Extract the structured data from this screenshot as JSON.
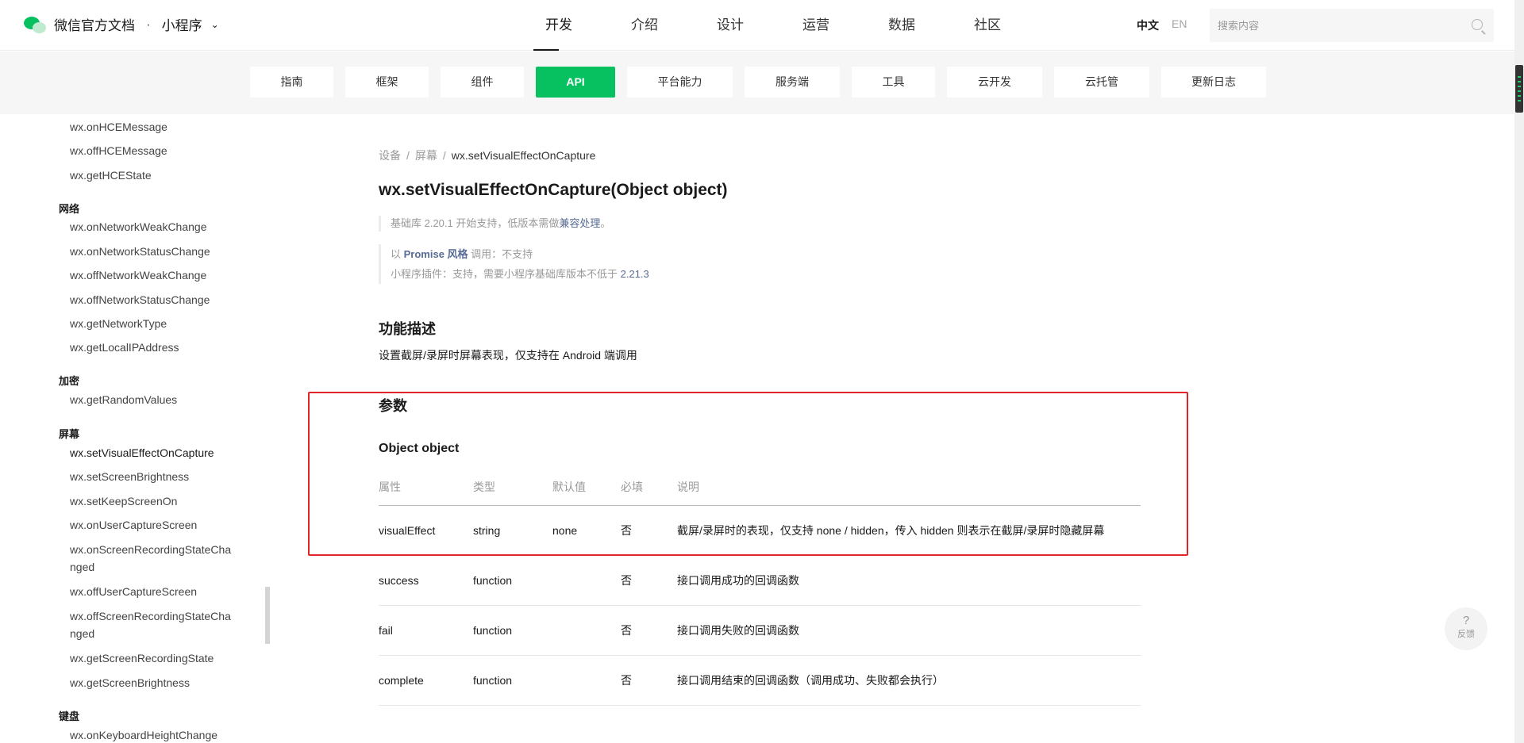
{
  "header": {
    "brand_title": "微信官方文档",
    "brand_dot": "·",
    "brand_section": "小程序",
    "nav": [
      "开发",
      "介绍",
      "设计",
      "运营",
      "数据",
      "社区"
    ],
    "active_nav": "开发",
    "lang_zh": "中文",
    "lang_en": "EN",
    "search_placeholder": "搜索内容"
  },
  "subnav": {
    "items": [
      "指南",
      "框架",
      "组件",
      "API",
      "平台能力",
      "服务端",
      "工具",
      "云开发",
      "云托管",
      "更新日志"
    ],
    "active": "API",
    "accent_color": "#07c160"
  },
  "sidebar": {
    "groups": [
      {
        "title": "",
        "items": [
          "wx.onHCEMessage",
          "wx.offHCEMessage",
          "wx.getHCEState"
        ]
      },
      {
        "title": "网络",
        "items": [
          "wx.onNetworkWeakChange",
          "wx.onNetworkStatusChange",
          "wx.offNetworkWeakChange",
          "wx.offNetworkStatusChange",
          "wx.getNetworkType",
          "wx.getLocalIPAddress"
        ]
      },
      {
        "title": "加密",
        "items": [
          "wx.getRandomValues"
        ]
      },
      {
        "title": "屏幕",
        "items": [
          "wx.setVisualEffectOnCapture",
          "wx.setScreenBrightness",
          "wx.setKeepScreenOn",
          "wx.onUserCaptureScreen",
          "wx.onScreenRecordingStateChanged",
          "wx.offUserCaptureScreen",
          "wx.offScreenRecordingStateChanged",
          "wx.getScreenRecordingState",
          "wx.getScreenBrightness"
        ]
      },
      {
        "title": "键盘",
        "items": [
          "wx.onKeyboardHeightChange"
        ]
      }
    ],
    "wrapped": {
      "onScreenRecordingStateChanged": [
        "wx.onScreenRecordingStateCha",
        "nged"
      ],
      "offScreenRecordingStateChanged": [
        "wx.offScreenRecordingStateCha",
        "nged"
      ]
    }
  },
  "content": {
    "breadcrumb": [
      "设备",
      "屏幕",
      "wx.setVisualEffectOnCapture"
    ],
    "breadcrumb_sep": "/",
    "title": "wx.setVisualEffectOnCapture(Object object)",
    "support_note": {
      "prefix": "基础库 2.20.1 开始支持，低版本需做",
      "link": "兼容处理",
      "suffix": "。"
    },
    "promise_note": {
      "prefix": "以 ",
      "link": "Promise 风格",
      "suffix": " 调用：不支持"
    },
    "plugin_note": {
      "prefix": "小程序插件：支持，需要小程序基础库版本不低于 ",
      "link": "2.21.3"
    },
    "section_desc_title": "功能描述",
    "section_desc": "设置截屏/录屏时屏幕表现，仅支持在 Android 端调用",
    "section_params_title": "参数",
    "param_object_title": "Object object",
    "table": {
      "headers": [
        "属性",
        "类型",
        "默认值",
        "必填",
        "说明"
      ],
      "rows": [
        [
          "visualEffect",
          "string",
          "none",
          "否",
          "截屏/录屏时的表现，仅支持 none / hidden，传入 hidden 则表示在截屏/录屏时隐藏屏幕"
        ],
        [
          "success",
          "function",
          "",
          "否",
          "接口调用成功的回调函数"
        ],
        [
          "fail",
          "function",
          "",
          "否",
          "接口调用失败的回调函数"
        ],
        [
          "complete",
          "function",
          "",
          "否",
          "接口调用结束的回调函数（调用成功、失败都会执行）"
        ]
      ]
    },
    "highlight_color": "#e0262b"
  },
  "feedback": {
    "icon": "?",
    "label": "反馈"
  }
}
